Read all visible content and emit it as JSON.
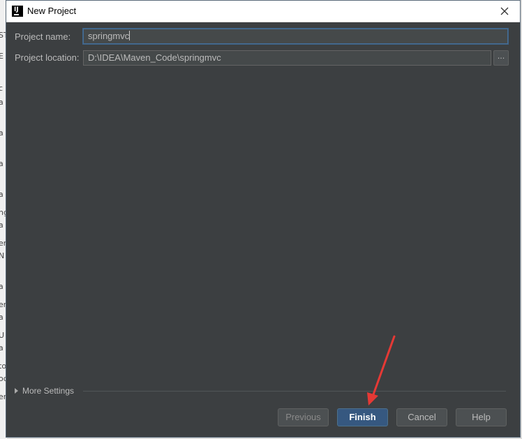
{
  "window": {
    "title": "New Project",
    "icon": "intellij-app-icon",
    "icon_glyph": "IJ"
  },
  "form": {
    "project_name_label": "Project name:",
    "project_name_value": "springmvc",
    "project_location_label": "Project location:",
    "project_location_value": "D:\\IDEA\\Maven_Code\\springmvc",
    "browse_label": "..."
  },
  "more_settings": {
    "label": "More Settings",
    "expanded": false
  },
  "buttons": {
    "previous": "Previous",
    "finish": "Finish",
    "cancel": "Cancel",
    "help": "Help"
  },
  "background_strip": [
    "ST",
    "E",
    "c",
    "a",
    "a",
    "a",
    "a",
    "ng",
    "a",
    "er",
    "N",
    "a",
    "er",
    "a",
    "U",
    "a",
    "to",
    "oc",
    "er"
  ],
  "colors": {
    "dialog_bg": "#3c3f41",
    "accent_blue": "#365880",
    "annotation_red": "#e53935"
  }
}
